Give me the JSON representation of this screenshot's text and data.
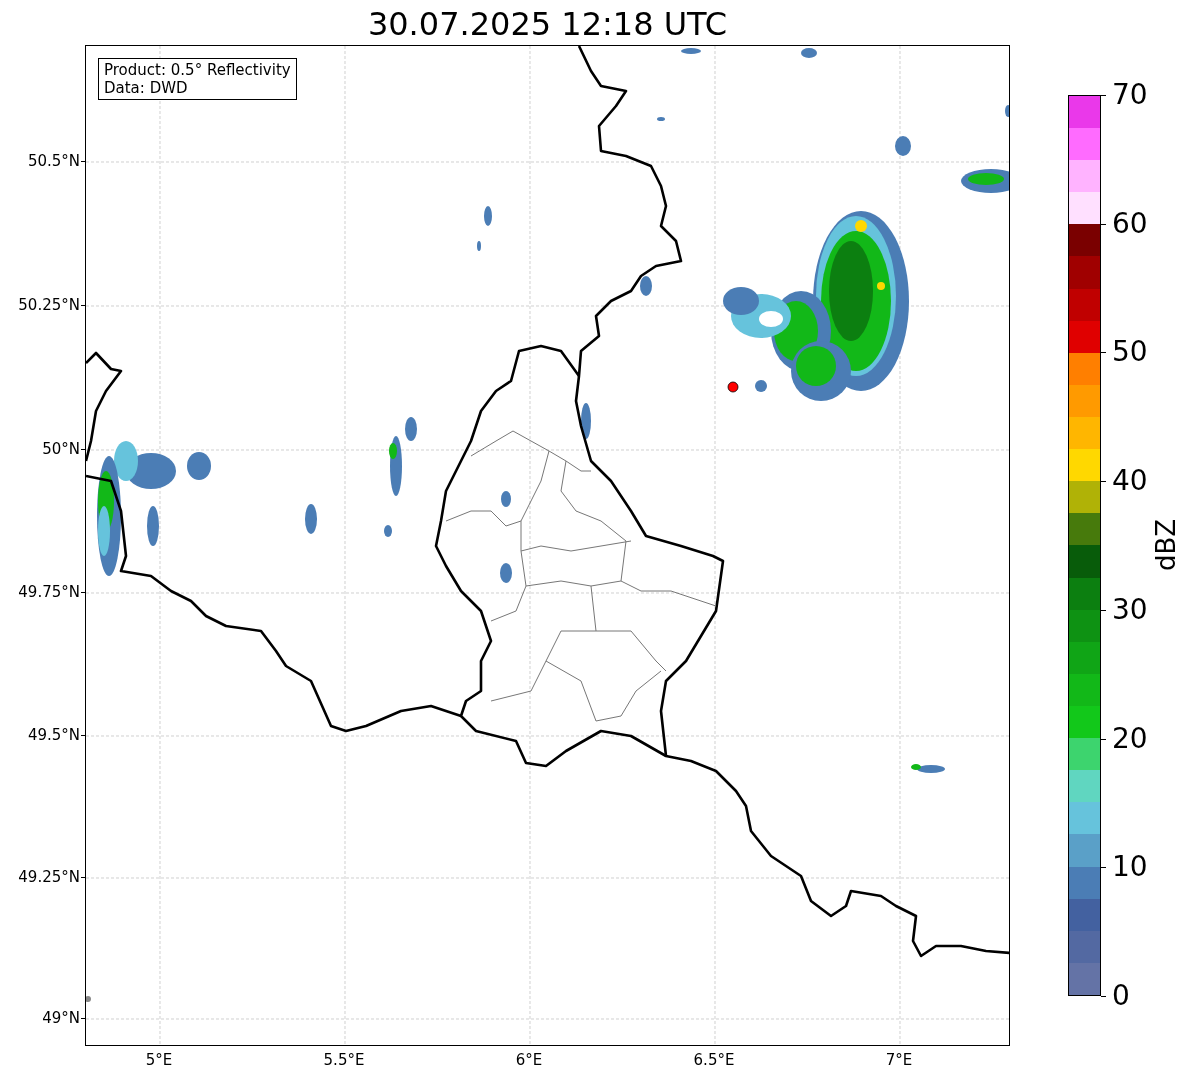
{
  "title": "30.07.2025 12:18 UTC",
  "info_box": [
    "Product: 0.5° Reflectivity",
    "Data: DWD"
  ],
  "map": {
    "lat_ticks": [
      "50.5°N",
      "50.25°N",
      "50°N",
      "49.75°N",
      "49.5°N",
      "49.25°N",
      "49°N"
    ],
    "lon_ticks": [
      "5°E",
      "5.5°E",
      "6°E",
      "6.5°E",
      "7°E"
    ]
  },
  "colorbar": {
    "label": "dBZ",
    "ticks": [
      "70",
      "60",
      "50",
      "40",
      "30",
      "20",
      "10",
      "0"
    ],
    "levels": [
      {
        "color": "#6473a6"
      },
      {
        "color": "#5369a2"
      },
      {
        "color": "#4361a0"
      },
      {
        "color": "#4b7db5"
      },
      {
        "color": "#5aa0c8"
      },
      {
        "color": "#66c3dc"
      },
      {
        "color": "#60d6c0"
      },
      {
        "color": "#3dd46e"
      },
      {
        "color": "#12c81a"
      },
      {
        "color": "#12b818"
      },
      {
        "color": "#10a516"
      },
      {
        "color": "#0e9213"
      },
      {
        "color": "#0c7f10"
      },
      {
        "color": "#085c0a"
      },
      {
        "color": "#477a0c"
      },
      {
        "color": "#b0b206"
      },
      {
        "color": "#ffd800"
      },
      {
        "color": "#ffb600"
      },
      {
        "color": "#ff9a00"
      },
      {
        "color": "#ff7f00"
      },
      {
        "color": "#e00000"
      },
      {
        "color": "#c00000"
      },
      {
        "color": "#a00000"
      },
      {
        "color": "#7a0000"
      },
      {
        "color": "#ffe0ff"
      },
      {
        "color": "#ffb3ff"
      },
      {
        "color": "#ff6bff"
      },
      {
        "color": "#ea38ea"
      }
    ]
  }
}
